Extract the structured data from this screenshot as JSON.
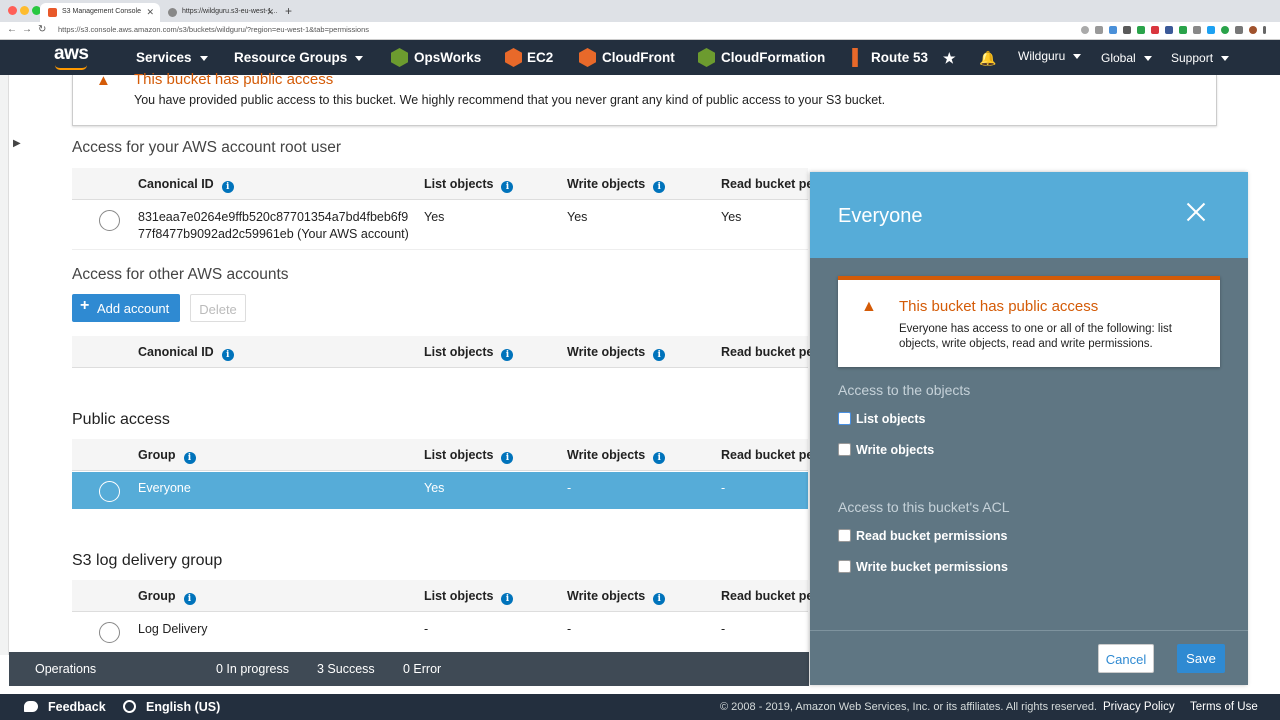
{
  "browser": {
    "tabs": [
      {
        "title": "S3 Management Console",
        "active": true,
        "favicon_color": "#e8592a"
      },
      {
        "title": "https://wildguru.s3-eu-west-1...",
        "active": false,
        "favicon_color": "#888888"
      }
    ],
    "url": "https://s3.console.aws.amazon.com/s3/buckets/wildguru/?region=eu-west-1&tab=permissions"
  },
  "awsnav": {
    "logo": "aws",
    "services": "Services",
    "resource_groups": "Resource Groups",
    "shortcuts": [
      {
        "label": "OpsWorks",
        "icon": "opsworks-icon",
        "color": "#6c9b2f"
      },
      {
        "label": "EC2",
        "icon": "ec2-icon",
        "color": "#e8692a"
      },
      {
        "label": "CloudFront",
        "icon": "cloudfront-icon",
        "color": "#e8692a"
      },
      {
        "label": "CloudFormation",
        "icon": "cloudformation-icon",
        "color": "#6c9b2f"
      },
      {
        "label": "Route 53",
        "icon": "route53-icon",
        "color": "#e8692a"
      }
    ],
    "account": "Wildguru",
    "region": "Global",
    "support": "Support"
  },
  "warning": {
    "title": "This bucket has public access",
    "text": "You have provided public access to this bucket. We highly recommend that you never grant any kind of public access to your S3 bucket."
  },
  "root_user": {
    "title": "Access for your AWS account root user",
    "headers": {
      "id": "Canonical ID",
      "list": "List objects",
      "write": "Write objects",
      "read": "Read bucket pe"
    },
    "row": {
      "id_line1": "831eaa7e0264e9ffb520c87701354a7bd4fbeb6f9",
      "id_line2": "77f8477b9092ad2c59961eb (Your AWS account)",
      "list": "Yes",
      "write": "Yes",
      "read": "Yes"
    }
  },
  "other_accounts": {
    "title": "Access for other AWS accounts",
    "add_button": "Add account",
    "delete_button": "Delete",
    "headers": {
      "id": "Canonical ID",
      "list": "List objects",
      "write": "Write objects",
      "read": "Read bucket pe"
    }
  },
  "public_access": {
    "title": "Public access",
    "headers": {
      "group": "Group",
      "list": "List objects",
      "write": "Write objects",
      "read": "Read bucket pe"
    },
    "row": {
      "group": "Everyone",
      "list": "Yes",
      "write": "-",
      "read": "-"
    }
  },
  "log_delivery": {
    "title": "S3 log delivery group",
    "headers": {
      "group": "Group",
      "list": "List objects",
      "write": "Write objects",
      "read": "Read bucket pe"
    },
    "row": {
      "group": "Log Delivery",
      "list": "-",
      "write": "-",
      "read": "-"
    }
  },
  "operations": {
    "label": "Operations",
    "in_progress": "0 In progress",
    "success": "3 Success",
    "error": "0 Error"
  },
  "footer": {
    "feedback": "Feedback",
    "language": "English (US)",
    "copyright": "© 2008 - 2019, Amazon Web Services, Inc. or its affiliates. All rights reserved.",
    "privacy": "Privacy Policy",
    "terms": "Terms of Use"
  },
  "panel": {
    "title": "Everyone",
    "warning_title": "This bucket has public access",
    "warning_text": "Everyone has access to one or all of the following: list objects, write objects, read and write permissions.",
    "objects_section": "Access to the objects",
    "list_objects": "List objects",
    "write_objects": "Write objects",
    "acl_section": "Access to this bucket's ACL",
    "read_perms": "Read bucket permissions",
    "write_perms": "Write bucket permissions",
    "cancel": "Cancel",
    "save": "Save",
    "checked": {
      "list_objects": false,
      "write_objects": false,
      "read_perms": false,
      "write_perms": false
    }
  }
}
